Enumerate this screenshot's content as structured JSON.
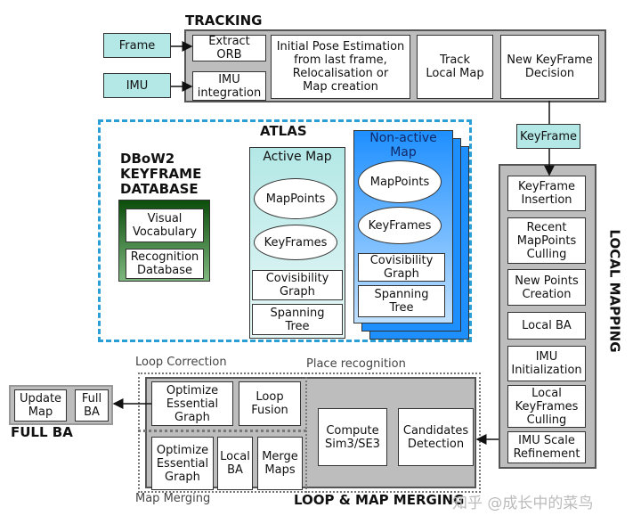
{
  "tracking": {
    "title": "TRACKING",
    "frame": "Frame",
    "imu": "IMU",
    "extract_orb": "Extract\nORB",
    "imu_integration": "IMU\nintegration",
    "initial_pose": "Initial Pose Estimation\nfrom last frame,\nRelocalisation or\nMap creation",
    "track_local_map": "Track\nLocal Map",
    "new_keyframe_decision": "New KeyFrame\nDecision"
  },
  "keyframe": "KeyFrame",
  "local_mapping": {
    "title": "LOCAL MAPPING",
    "items": [
      "KeyFrame\nInsertion",
      "Recent\nMapPoints\nCulling",
      "New Points\nCreation",
      "Local BA",
      "IMU\nInitialization",
      "Local\nKeyFrames\nCulling",
      "IMU Scale\nRefinement"
    ]
  },
  "atlas": {
    "title": "ATLAS",
    "dbow2_title": "DBoW2\nKEYFRAME\nDATABASE",
    "visual_vocabulary": "Visual\nVocabulary",
    "recognition_database": "Recognition\nDatabase",
    "active_map": {
      "title": "Active Map",
      "mappoints": "MapPoints",
      "keyframes": "KeyFrames",
      "covisibility": "Covisibility\nGraph",
      "spanning": "Spanning\nTree"
    },
    "nonactive_map": {
      "title": "Non-active\nMap",
      "mappoints": "MapPoints",
      "keyframes": "KeyFrames",
      "covisibility": "Covisibility\nGraph",
      "spanning": "Spanning\nTree"
    }
  },
  "loop": {
    "loop_correction": "Loop Correction",
    "place_recognition": "Place recognition",
    "map_merging": "Map Merging",
    "title": "LOOP & MAP MERGING",
    "optimize_eg_1": "Optimize\nEssential\nGraph",
    "loop_fusion": "Loop\nFusion",
    "optimize_eg_2": "Optimize\nEssential\nGraph",
    "local_ba": "Local\nBA",
    "merge_maps": "Merge\nMaps",
    "compute_sim3": "Compute\nSim3/SE3",
    "candidates": "Candidates\nDetection"
  },
  "full_ba": {
    "title": "FULL BA",
    "update_map": "Update\nMap",
    "full_ba": "Full\nBA"
  },
  "watermark": "知乎 @成长中的菜鸟",
  "colors": {
    "cyan": "#b3e8e6",
    "blue": "#1e8fff",
    "dark_green": "#0b4d0b",
    "atlas_dash": "#2a9fd6"
  }
}
